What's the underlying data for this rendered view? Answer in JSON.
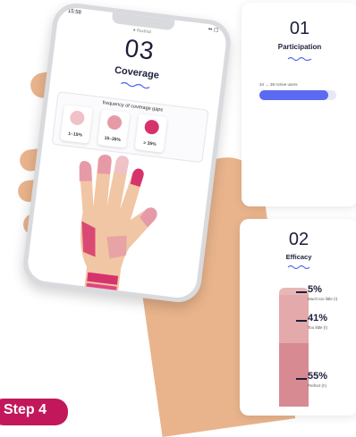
{
  "colors": {
    "accent": "#5b6af0",
    "magenta": "#d6336c",
    "navy": "#1d1f3a",
    "skin": "#e9b48c"
  },
  "phone": {
    "status_time": "15:58",
    "status_right": "▪▪ ▢",
    "url": "● fluxtrial",
    "step_number": "03",
    "title": "Coverage",
    "freq_title": "frequency of coverage gaps",
    "chips": [
      {
        "label": "1–15%",
        "color": "#efc2c8"
      },
      {
        "label": "15–35%",
        "color": "#e69aa8"
      },
      {
        "label": "> 35%",
        "color": "#d6336c"
      }
    ]
  },
  "card1": {
    "number": "01",
    "title": "Participation",
    "slider_caption": "34 → 38  Active users",
    "progress_fraction": 0.9
  },
  "card2": {
    "number": "02",
    "title": "Efficacy",
    "levels": [
      {
        "pct": "5%",
        "label": "Much too little (!)"
      },
      {
        "pct": "41%",
        "label": "Too little (!)"
      },
      {
        "pct": "55%",
        "label": "Perfect (!!)"
      }
    ]
  },
  "step_badge": "Step 4"
}
